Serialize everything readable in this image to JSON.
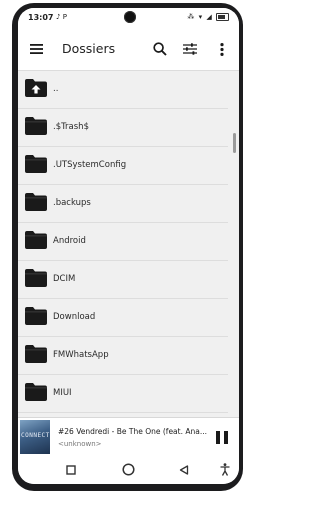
{
  "status": {
    "time": "13:07",
    "extra": "♪ P",
    "icons": "⁂ ▾ ◢"
  },
  "toolbar": {
    "title": "Dossiers"
  },
  "folders": [
    {
      "label": "..",
      "up": true
    },
    {
      "label": ".$Trash$"
    },
    {
      "label": ".UTSystemConfig"
    },
    {
      "label": ".backups"
    },
    {
      "label": "Android"
    },
    {
      "label": "DCIM"
    },
    {
      "label": "Download"
    },
    {
      "label": "FMWhatsApp"
    },
    {
      "label": "MIUI"
    },
    {
      "label": ""
    }
  ],
  "player": {
    "title": "#26 Vendredi -  Be The One (feat. Ana...",
    "artist": "<unknown>",
    "art_text": "CONNECT"
  },
  "colors": {
    "list_bg": "#f0f0f0",
    "bar_bg": "#ffffff",
    "icon": "#1a1a1a"
  }
}
